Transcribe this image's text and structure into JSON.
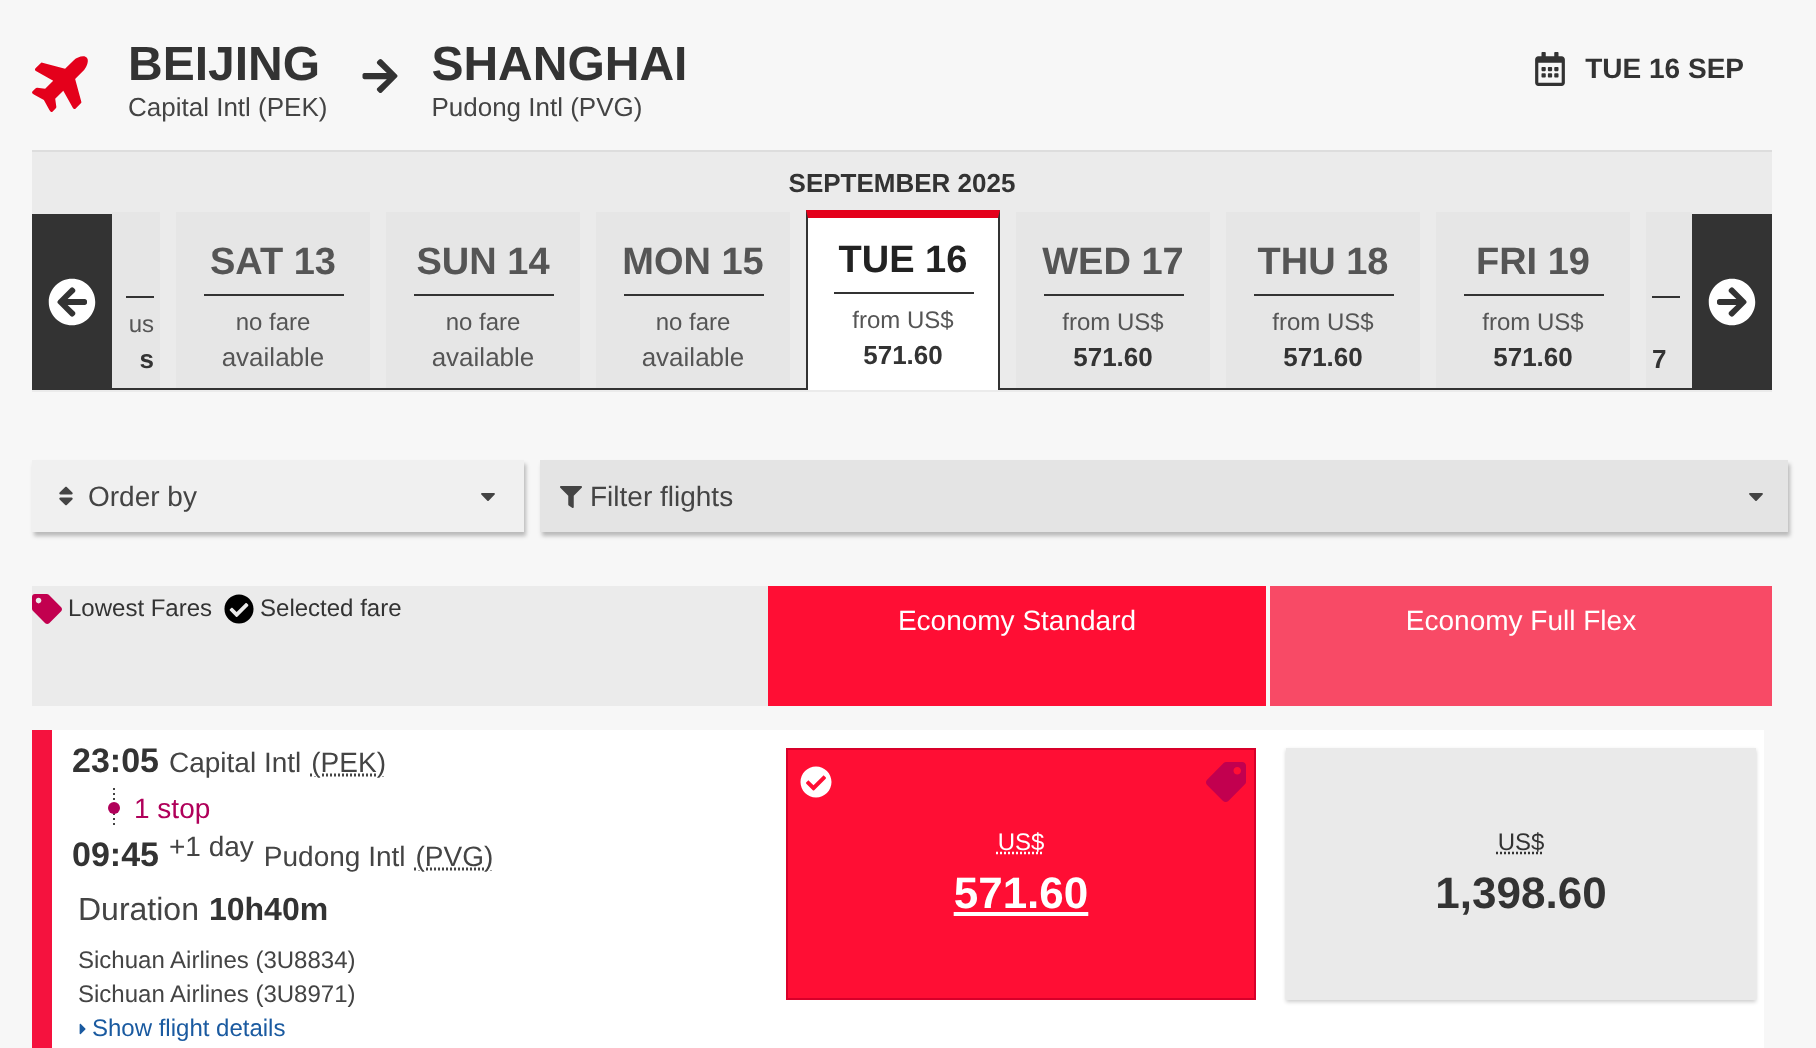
{
  "route": {
    "origin": {
      "city": "BEIJING",
      "airport": "Capital Intl (PEK)"
    },
    "destination": {
      "city": "SHANGHAI",
      "airport": "Pudong Intl (PVG)"
    }
  },
  "selected_date": "TUE 16 SEP",
  "calendar": {
    "month": "SEPTEMBER 2025",
    "days": [
      {
        "kind": "partial_start",
        "line1": "us",
        "line2": "s"
      },
      {
        "kind": "day",
        "day": "SAT 13",
        "line1": "no fare",
        "line2": "available",
        "has_fare": false,
        "selected": false
      },
      {
        "kind": "day",
        "day": "SUN 14",
        "line1": "no fare",
        "line2": "available",
        "has_fare": false,
        "selected": false
      },
      {
        "kind": "day",
        "day": "MON 15",
        "line1": "no fare",
        "line2": "available",
        "has_fare": false,
        "selected": false
      },
      {
        "kind": "day",
        "day": "TUE 16",
        "line1": "from US$",
        "line2": "571.60",
        "has_fare": true,
        "selected": true
      },
      {
        "kind": "day",
        "day": "WED 17",
        "line1": "from US$",
        "line2": "571.60",
        "has_fare": true,
        "selected": false
      },
      {
        "kind": "day",
        "day": "THU 18",
        "line1": "from US$",
        "line2": "571.60",
        "has_fare": true,
        "selected": false
      },
      {
        "kind": "day",
        "day": "FRI 19",
        "line1": "from US$",
        "line2": "571.60",
        "has_fare": true,
        "selected": false
      },
      {
        "kind": "partial_end",
        "line2": "7"
      }
    ]
  },
  "order_by": {
    "label": "Order by"
  },
  "filter": {
    "label": "Filter flights"
  },
  "legend": [
    {
      "kind": "tag",
      "label": "Lowest Fares"
    },
    {
      "kind": "check",
      "label": "Selected fare"
    }
  ],
  "fare_columns": [
    {
      "label": "Economy Standard",
      "selected": true
    },
    {
      "label": "Economy Full Flex",
      "selected": false
    }
  ],
  "flight": {
    "departure_time": "23:05",
    "departure_airport": "Capital Intl",
    "departure_code": "(PEK)",
    "stops": "1 stop",
    "arrival_time": "09:45",
    "day_offset": "+1 day",
    "arrival_airport": "Pudong Intl",
    "arrival_code": "(PVG)",
    "duration_label": "Duration",
    "duration": "10h40m",
    "carriers": [
      "Sichuan Airlines (3U8834)",
      "Sichuan Airlines (3U8971)"
    ],
    "details_link": "Show flight details",
    "fares": [
      {
        "currency": "US$",
        "amount": "571.60",
        "selected": true,
        "lowest": true
      },
      {
        "currency": "US$",
        "amount": "1,398.60",
        "selected": false,
        "lowest": false
      }
    ]
  }
}
